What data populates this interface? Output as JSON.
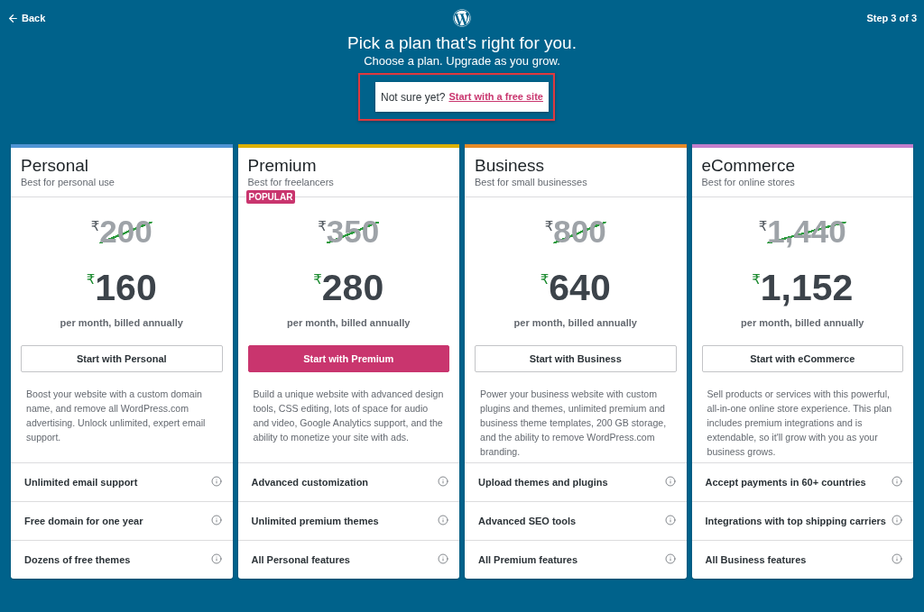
{
  "header": {
    "back": {
      "label": "Back"
    },
    "step": "Step 3 of 3",
    "title": "Pick a plan that's right for you.",
    "subtitle": "Choose a plan. Upgrade as you grow."
  },
  "free_site_prompt": {
    "text": "Not sure yet?",
    "link": "Start with a free site",
    "highlighted": true
  },
  "plans": [
    {
      "name": "Personal",
      "tagline": "Best for personal use",
      "color": "#4f94d4",
      "original_price": {
        "currency": "₹",
        "amount": "200"
      },
      "price": {
        "currency": "₹",
        "amount": "160"
      },
      "billing": "per month, billed annually",
      "button": {
        "label": "Start with Personal",
        "primary": false
      },
      "description": "Boost your website with a custom domain name, and remove all WordPress.com advertising. Unlock unlimited, expert email support.",
      "features": [
        "Unlimited email support",
        "Free domain for one year",
        "Dozens of free themes"
      ]
    },
    {
      "name": "Premium",
      "tagline": "Best for freelancers",
      "badge": "POPULAR",
      "color": "#dcb000",
      "original_price": {
        "currency": "₹",
        "amount": "350"
      },
      "price": {
        "currency": "₹",
        "amount": "280"
      },
      "billing": "per month, billed annually",
      "button": {
        "label": "Start with Premium",
        "primary": true
      },
      "description": "Build a unique website with advanced design tools, CSS editing, lots of space for audio and video, Google Analytics support, and the ability to monetize your site with ads.",
      "features": [
        "Advanced customization",
        "Unlimited premium themes",
        "All Personal features"
      ]
    },
    {
      "name": "Business",
      "tagline": "Best for small businesses",
      "color": "#e68b28",
      "original_price": {
        "currency": "₹",
        "amount": "800"
      },
      "price": {
        "currency": "₹",
        "amount": "640"
      },
      "billing": "per month, billed annually",
      "button": {
        "label": "Start with Business",
        "primary": false
      },
      "description": "Power your business website with custom plugins and themes, unlimited premium and business theme templates, 200 GB storage, and the ability to remove WordPress.com branding.",
      "features": [
        "Upload themes and plugins",
        "Advanced SEO tools",
        "All Premium features"
      ]
    },
    {
      "name": "eCommerce",
      "tagline": "Best for online stores",
      "color": "#c47fcc",
      "original_price": {
        "currency": "₹",
        "amount": "1,440"
      },
      "price": {
        "currency": "₹",
        "amount": "1,152"
      },
      "billing": "per month, billed annually",
      "button": {
        "label": "Start with eCommerce",
        "primary": false
      },
      "description": "Sell products or services with this powerful, all-in-one online store experience. This plan includes premium integrations and is extendable, so it'll grow with you as your business grows.",
      "features": [
        "Accept payments in 60+ countries",
        "Integrations with top shipping carriers",
        "All Business features"
      ]
    }
  ]
}
